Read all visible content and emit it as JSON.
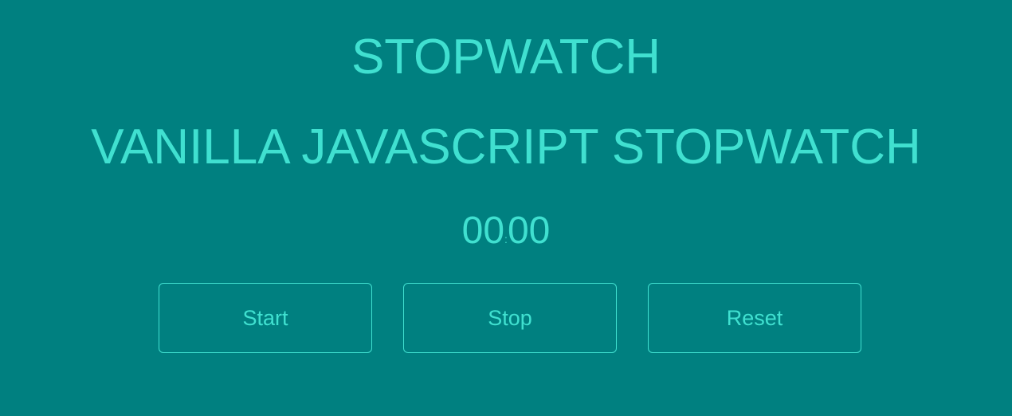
{
  "header": {
    "title": "STOPWATCH",
    "subtitle": "VANILLA JAVASCRIPT STOPWATCH"
  },
  "timer": {
    "seconds": "00",
    "separator": ":",
    "tens": "00"
  },
  "buttons": {
    "start": "Start",
    "stop": "Stop",
    "reset": "Reset"
  },
  "colors": {
    "background": "#008080",
    "accent": "#40e0d0"
  }
}
